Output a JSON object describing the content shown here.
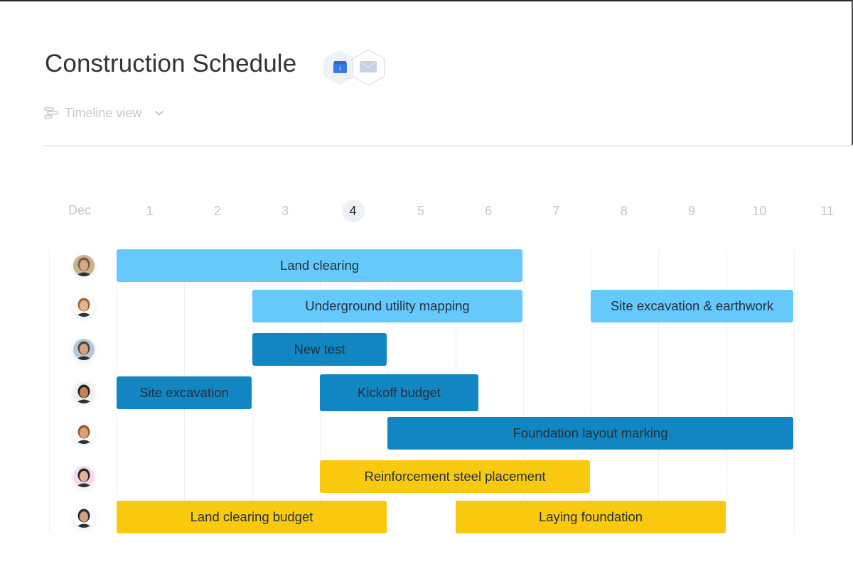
{
  "page": {
    "title": "Construction Schedule",
    "integrations": [
      {
        "name": "google-calendar",
        "icon": "calendar-icon",
        "day_glyph": "1",
        "color": "#3b78e7"
      },
      {
        "name": "email",
        "icon": "mail-icon",
        "color": "#c8d1e6"
      }
    ],
    "view_selector": {
      "label": "Timeline view",
      "icon": "timeline-icon"
    }
  },
  "timeline": {
    "month": "Dec",
    "days": [
      "1",
      "2",
      "3",
      "4",
      "5",
      "6",
      "7",
      "8",
      "9",
      "10",
      "11"
    ],
    "today": "4",
    "colors": {
      "light_blue": "#66c9fb",
      "dark_blue": "#1186c2",
      "yellow": "#f8c90f"
    },
    "rows": [
      {
        "assignee": "Team member 1",
        "avatar": {
          "skin": "#d7a98b",
          "hair": "#7b5a3c",
          "bg": "#c7b48f"
        },
        "tasks": [
          {
            "label": "Land clearing",
            "start": 1,
            "end": 7,
            "color": "light_blue"
          }
        ]
      },
      {
        "assignee": "Team member 2",
        "avatar": {
          "skin": "#e5b38f",
          "hair": "#a0642e",
          "bg": "#ffffff"
        },
        "tasks": [
          {
            "label": "Underground utility mapping",
            "start": 3,
            "end": 7,
            "color": "light_blue"
          },
          {
            "label": "Site excavation & earthwork",
            "start": 8,
            "end": 11,
            "color": "light_blue"
          }
        ]
      },
      {
        "assignee": "Team member 3",
        "avatar": {
          "skin": "#d9a27f",
          "hair": "#4a4a4a",
          "bg": "#b8c6d6"
        },
        "tasks": [
          {
            "label": "New test",
            "start": 3,
            "end": 5,
            "color": "dark_blue"
          }
        ]
      },
      {
        "assignee": "Team member 4",
        "avatar": {
          "skin": "#c6835a",
          "hair": "#2b1f1a",
          "bg": "#eef0f2"
        },
        "tasks": [
          {
            "label": "Site excavation",
            "start": 1,
            "end": 3,
            "color": "dark_blue"
          },
          {
            "label": "Kickoff budget",
            "start": 4,
            "end": 6.35,
            "color": "dark_blue"
          }
        ]
      },
      {
        "assignee": "Team member 5",
        "avatar": {
          "skin": "#d9a07a",
          "hair": "#9b5a2c",
          "bg": "#ffffff"
        },
        "tasks": [
          {
            "label": "Foundation layout marking",
            "start": 5,
            "end": 11,
            "color": "dark_blue"
          }
        ]
      },
      {
        "assignee": "Team member 6",
        "avatar": {
          "skin": "#e0b394",
          "hair": "#2a2523",
          "bg": "#f6d9ee"
        },
        "tasks": [
          {
            "label": "Reinforcement steel placement",
            "start": 4,
            "end": 8,
            "color": "yellow"
          }
        ]
      },
      {
        "assignee": "Team member 7",
        "avatar": {
          "skin": "#d2a080",
          "hair": "#2a2a2a",
          "bg": "#ffffff"
        },
        "tasks": [
          {
            "label": "Land clearing budget",
            "start": 1,
            "end": 5,
            "color": "yellow"
          },
          {
            "label": "Laying foundation",
            "start": 6,
            "end": 10,
            "color": "yellow"
          }
        ]
      }
    ]
  }
}
